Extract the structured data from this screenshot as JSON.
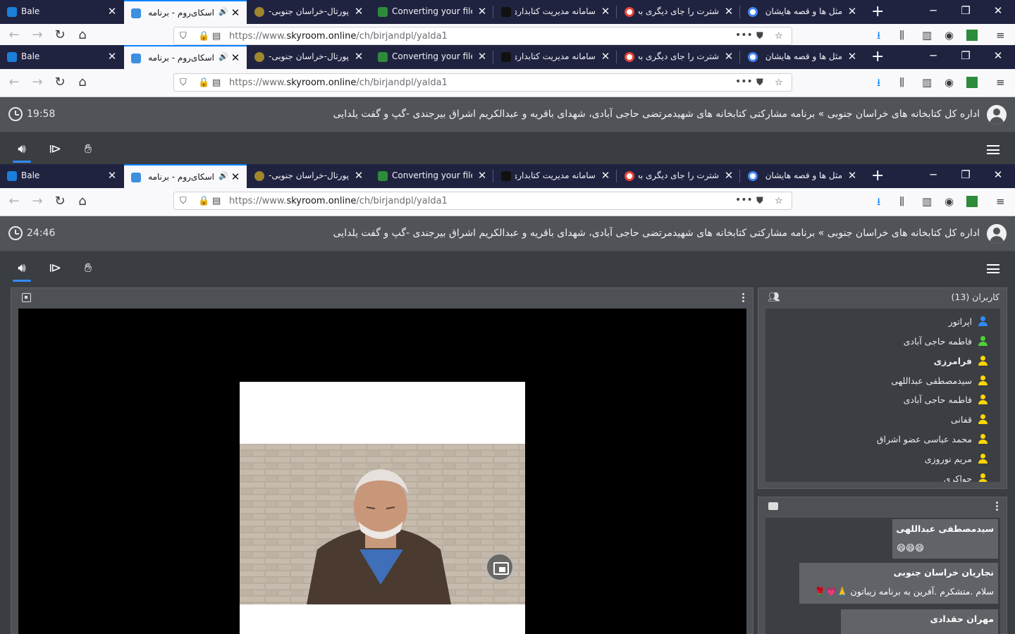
{
  "browser": {
    "tabs": [
      {
        "label": "Bale",
        "dir": "ltr",
        "favicon_color": "#1a7fd8",
        "active": false
      },
      {
        "label": "اسکای‌روم - برنامه م",
        "dir": "rtl",
        "favicon_color": "#3d8fe0",
        "active": true,
        "audio": "🔊"
      },
      {
        "label": "پورتال-خراسان جنوبی-ج",
        "dir": "rtl",
        "favicon_color": "#a0862e",
        "active": false
      },
      {
        "label": "Converting your file",
        "dir": "ltr",
        "favicon_color": "#2e8b3a",
        "active": false
      },
      {
        "label": "سامانه مدیریت کتابداری",
        "dir": "rtl",
        "favicon_color": "#111111",
        "active": false
      },
      {
        "label": "شترت را جای دیگری بخو",
        "dir": "rtl",
        "favicon_color": "#ea4335",
        "active": false
      },
      {
        "label": "مثل ها و قصه هایشان ه",
        "dir": "rtl",
        "favicon_color": "#4285f4",
        "active": false
      }
    ],
    "new_tab_label": "+",
    "url_prefix": "https://www.",
    "url_host": "skyroom.online",
    "url_path": "/ch/birjandpl/yalda1",
    "page_actions_label": "•••"
  },
  "skyroom": {
    "title": "اداره کل کتابخانه های خراسان جنوبی » برنامه مشارکتی کتابخانه های شهیدمرتضی حاجی آبادی، شهدای باقریه و عبدالکریم اشراق بیرجندی -گپ و گفت یلدایی",
    "timer_first": "19:58",
    "timer_second": "24:46",
    "users_header": "کاربران (13)",
    "users": [
      {
        "name": "اپراتور",
        "color": "#2f8cff",
        "bold": false
      },
      {
        "name": "فاطمه حاجی آبادی",
        "color": "#4cd137",
        "bold": false
      },
      {
        "name": "فرامرزی",
        "color": "#ffd600",
        "bold": true
      },
      {
        "name": "سیدمصطفی عبداللهی",
        "color": "#ffd600",
        "bold": false
      },
      {
        "name": "فاطمه حاجی آبادی",
        "color": "#ffd600",
        "bold": false
      },
      {
        "name": "قفانی",
        "color": "#ffd600",
        "bold": false
      },
      {
        "name": "محمد عباسی عضو اشراق",
        "color": "#ffd600",
        "bold": false
      },
      {
        "name": "مریم نوروزی",
        "color": "#ffd600",
        "bold": false
      },
      {
        "name": "جواکری",
        "color": "#ffd600",
        "bold": false
      }
    ],
    "chat": [
      {
        "sender": "سیدمصطفی عبداللهی",
        "text": "😄😄😄"
      },
      {
        "sender": "نجاریان خراسان جنوبی",
        "text": "سلام .متشکرم .آفرین به برنامه زیباتون 🙏💗🌹"
      },
      {
        "sender": "مهران حقدادی",
        "text": ""
      }
    ]
  }
}
